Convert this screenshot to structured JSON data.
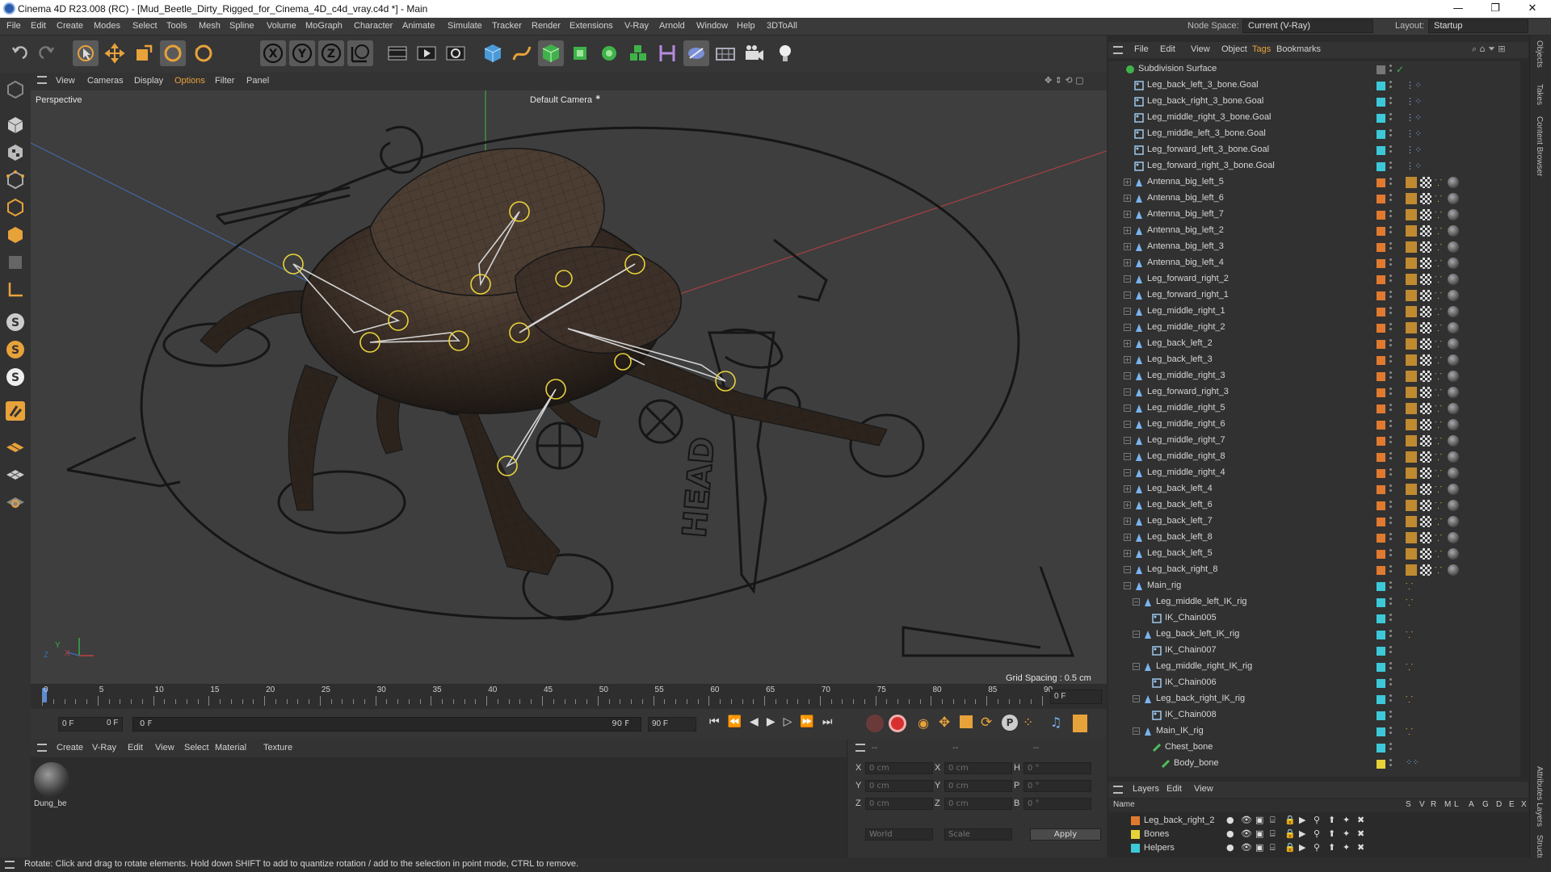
{
  "window": {
    "title": "Cinema 4D R23.008 (RC) - [Mud_Beetle_Dirty_Rigged_for_Cinema_4D_c4d_vray.c4d *] - Main",
    "controls": [
      "—",
      "❐",
      "✕"
    ]
  },
  "menubar": {
    "items": [
      "File",
      "Edit",
      "Create",
      "Modes",
      "Select",
      "Tools",
      "Mesh",
      "Spline",
      "Volume",
      "MoGraph",
      "Character",
      "Animate",
      "Simulate",
      "Tracker",
      "Render",
      "Extensions",
      "V-Ray",
      "Arnold",
      "Window",
      "Help",
      "3DToAll"
    ],
    "node_space_label": "Node Space:",
    "node_space_value": "Current (V-Ray)",
    "layout_label": "Layout:",
    "layout_value": "Startup"
  },
  "viewport": {
    "menu": [
      "View",
      "Cameras",
      "Display",
      "Options",
      "Filter",
      "Panel"
    ],
    "name": "Perspective",
    "camera": "Default Camera",
    "grid_spacing": "Grid Spacing : 0.5 cm",
    "axis_labels": {
      "x": "X",
      "y": "Y",
      "z": "Z"
    },
    "rig_text": "HEAD"
  },
  "timeline": {
    "ticks": [
      "0",
      "5",
      "10",
      "15",
      "20",
      "25",
      "30",
      "35",
      "40",
      "45",
      "50",
      "55",
      "60",
      "65",
      "70",
      "75",
      "80",
      "85",
      "90"
    ],
    "current_frame_field": "0 F",
    "start_field": "0 F",
    "range_start": "0 F",
    "range_end": "90 F",
    "end_field": "90 F"
  },
  "material_manager": {
    "menu": [
      "Create",
      "V-Ray",
      "Edit",
      "View",
      "Select",
      "Material",
      "Texture"
    ],
    "materials": [
      {
        "name": "Dung_be"
      }
    ]
  },
  "coordinates": {
    "header_dashes": [
      "--",
      "--",
      "--"
    ],
    "rows": [
      {
        "l1": "X",
        "v1": "0 cm",
        "l2": "X",
        "v2": "0 cm",
        "l3": "H",
        "v3": "0 °"
      },
      {
        "l1": "Y",
        "v1": "0 cm",
        "l2": "Y",
        "v2": "0 cm",
        "l3": "P",
        "v3": "0 °"
      },
      {
        "l1": "Z",
        "v1": "0 cm",
        "l2": "Z",
        "v2": "0 cm",
        "l3": "B",
        "v3": "0 °"
      }
    ],
    "space_value": "World",
    "mode_value": "Scale",
    "apply_label": "Apply"
  },
  "object_manager": {
    "menu": [
      "File",
      "Edit",
      "View",
      "Object",
      "Tags",
      "Bookmarks"
    ],
    "objects": [
      {
        "name": "Subdivision Surface",
        "level": 0,
        "type": "subdiv",
        "color": "",
        "tags": "check"
      },
      {
        "name": "Leg_back_left_3_bone.Goal",
        "level": 1,
        "type": "null",
        "color": "#3cc8d8",
        "tags": "goal"
      },
      {
        "name": "Leg_back_right_3_bone.Goal",
        "level": 1,
        "type": "null",
        "color": "#3cc8d8",
        "tags": "goal"
      },
      {
        "name": "Leg_middle_right_3_bone.Goal",
        "level": 1,
        "type": "null",
        "color": "#3cc8d8",
        "tags": "goal"
      },
      {
        "name": "Leg_middle_left_3_bone.Goal",
        "level": 1,
        "type": "null",
        "color": "#3cc8d8",
        "tags": "goal"
      },
      {
        "name": "Leg_forward_left_3_bone.Goal",
        "level": 1,
        "type": "null",
        "color": "#3cc8d8",
        "tags": "goal"
      },
      {
        "name": "Leg_forward_right_3_bone.Goal",
        "level": 1,
        "type": "null",
        "color": "#3cc8d8",
        "tags": "goal"
      },
      {
        "name": "Antenna_big_left_5",
        "level": 1,
        "type": "bone",
        "color": "#e07a30",
        "tags": "full"
      },
      {
        "name": "Antenna_big_left_6",
        "level": 1,
        "type": "bone",
        "color": "#e07a30",
        "tags": "full"
      },
      {
        "name": "Antenna_big_left_7",
        "level": 1,
        "type": "bone",
        "color": "#e07a30",
        "tags": "full"
      },
      {
        "name": "Antenna_big_left_2",
        "level": 1,
        "type": "bone",
        "color": "#e07a30",
        "tags": "full"
      },
      {
        "name": "Antenna_big_left_3",
        "level": 1,
        "type": "bone",
        "color": "#e07a30",
        "tags": "full"
      },
      {
        "name": "Antenna_big_left_4",
        "level": 1,
        "type": "bone",
        "color": "#e07a30",
        "tags": "full"
      },
      {
        "name": "Leg_forward_right_2",
        "level": 1,
        "type": "bone",
        "color": "#e07a30",
        "tags": "full"
      },
      {
        "name": "Leg_forward_right_1",
        "level": 1,
        "type": "bone",
        "color": "#e07a30",
        "tags": "full"
      },
      {
        "name": "Leg_middle_right_1",
        "level": 1,
        "type": "bone",
        "color": "#e07a30",
        "tags": "full"
      },
      {
        "name": "Leg_middle_right_2",
        "level": 1,
        "type": "bone",
        "color": "#e07a30",
        "tags": "full"
      },
      {
        "name": "Leg_back_left_2",
        "level": 1,
        "type": "bone",
        "color": "#e07a30",
        "tags": "full"
      },
      {
        "name": "Leg_back_left_3",
        "level": 1,
        "type": "bone",
        "color": "#e07a30",
        "tags": "full"
      },
      {
        "name": "Leg_middle_right_3",
        "level": 1,
        "type": "bone",
        "color": "#e07a30",
        "tags": "full"
      },
      {
        "name": "Leg_forward_right_3",
        "level": 1,
        "type": "bone",
        "color": "#e07a30",
        "tags": "full"
      },
      {
        "name": "Leg_middle_right_5",
        "level": 1,
        "type": "bone",
        "color": "#e07a30",
        "tags": "full"
      },
      {
        "name": "Leg_middle_right_6",
        "level": 1,
        "type": "bone",
        "color": "#e07a30",
        "tags": "full"
      },
      {
        "name": "Leg_middle_right_7",
        "level": 1,
        "type": "bone",
        "color": "#e07a30",
        "tags": "full"
      },
      {
        "name": "Leg_middle_right_8",
        "level": 1,
        "type": "bone",
        "color": "#e07a30",
        "tags": "full"
      },
      {
        "name": "Leg_middle_right_4",
        "level": 1,
        "type": "bone",
        "color": "#e07a30",
        "tags": "full"
      },
      {
        "name": "Leg_back_left_4",
        "level": 1,
        "type": "bone",
        "color": "#e07a30",
        "tags": "full"
      },
      {
        "name": "Leg_back_left_6",
        "level": 1,
        "type": "bone",
        "color": "#e07a30",
        "tags": "full"
      },
      {
        "name": "Leg_back_left_7",
        "level": 1,
        "type": "bone",
        "color": "#e07a30",
        "tags": "full"
      },
      {
        "name": "Leg_back_left_8",
        "level": 1,
        "type": "bone",
        "color": "#e07a30",
        "tags": "full"
      },
      {
        "name": "Leg_back_left_5",
        "level": 1,
        "type": "bone",
        "color": "#e07a30",
        "tags": "full"
      },
      {
        "name": "Leg_back_right_8",
        "level": 1,
        "type": "bone",
        "color": "#e07a30",
        "tags": "full"
      },
      {
        "name": "Main_rig",
        "level": 1,
        "type": "bone",
        "color": "#3cc8d8",
        "tags": "dot"
      },
      {
        "name": "Leg_middle_left_IK_rig",
        "level": 2,
        "type": "bone",
        "color": "#3cc8d8",
        "tags": "dot"
      },
      {
        "name": "IK_Chain005",
        "level": 3,
        "type": "null",
        "color": "#3cc8d8",
        "tags": ""
      },
      {
        "name": "Leg_back_left_IK_rig",
        "level": 2,
        "type": "bone",
        "color": "#3cc8d8",
        "tags": "dot"
      },
      {
        "name": "IK_Chain007",
        "level": 3,
        "type": "null",
        "color": "#3cc8d8",
        "tags": ""
      },
      {
        "name": "Leg_middle_right_IK_rig",
        "level": 2,
        "type": "bone",
        "color": "#3cc8d8",
        "tags": "dot"
      },
      {
        "name": "IK_Chain006",
        "level": 3,
        "type": "null",
        "color": "#3cc8d8",
        "tags": ""
      },
      {
        "name": "Leg_back_right_IK_rig",
        "level": 2,
        "type": "bone",
        "color": "#3cc8d8",
        "tags": "dot"
      },
      {
        "name": "IK_Chain008",
        "level": 3,
        "type": "null",
        "color": "#3cc8d8",
        "tags": ""
      },
      {
        "name": "Main_IK_rig",
        "level": 2,
        "type": "bone",
        "color": "#3cc8d8",
        "tags": "dot"
      },
      {
        "name": "Chest_bone",
        "level": 3,
        "type": "joint",
        "color": "#3cc8d8",
        "tags": ""
      },
      {
        "name": "Body_bone",
        "level": 4,
        "type": "joint",
        "color": "#e8d23a",
        "tags": "dots"
      }
    ]
  },
  "layer_manager": {
    "menu": [
      "Layers",
      "Edit",
      "View"
    ],
    "columns": [
      "Name",
      "S",
      "V",
      "R",
      "M",
      "L",
      "A",
      "G",
      "D",
      "E",
      "X"
    ],
    "layers": [
      {
        "name": "Leg_back_right_2",
        "color": "#e07a30"
      },
      {
        "name": "Bones",
        "color": "#e8d23a"
      },
      {
        "name": "Helpers",
        "color": "#3cc8d8"
      }
    ]
  },
  "right_tabs": [
    "Objects",
    "Takes",
    "Content Browser"
  ],
  "right_tabs_bottom": [
    "Attributes",
    "Layers",
    "Structure"
  ],
  "statusbar": {
    "text": "Rotate: Click and drag to rotate elements. Hold down SHIFT to add to quantize rotation / add to the selection in point mode, CTRL to remove."
  }
}
